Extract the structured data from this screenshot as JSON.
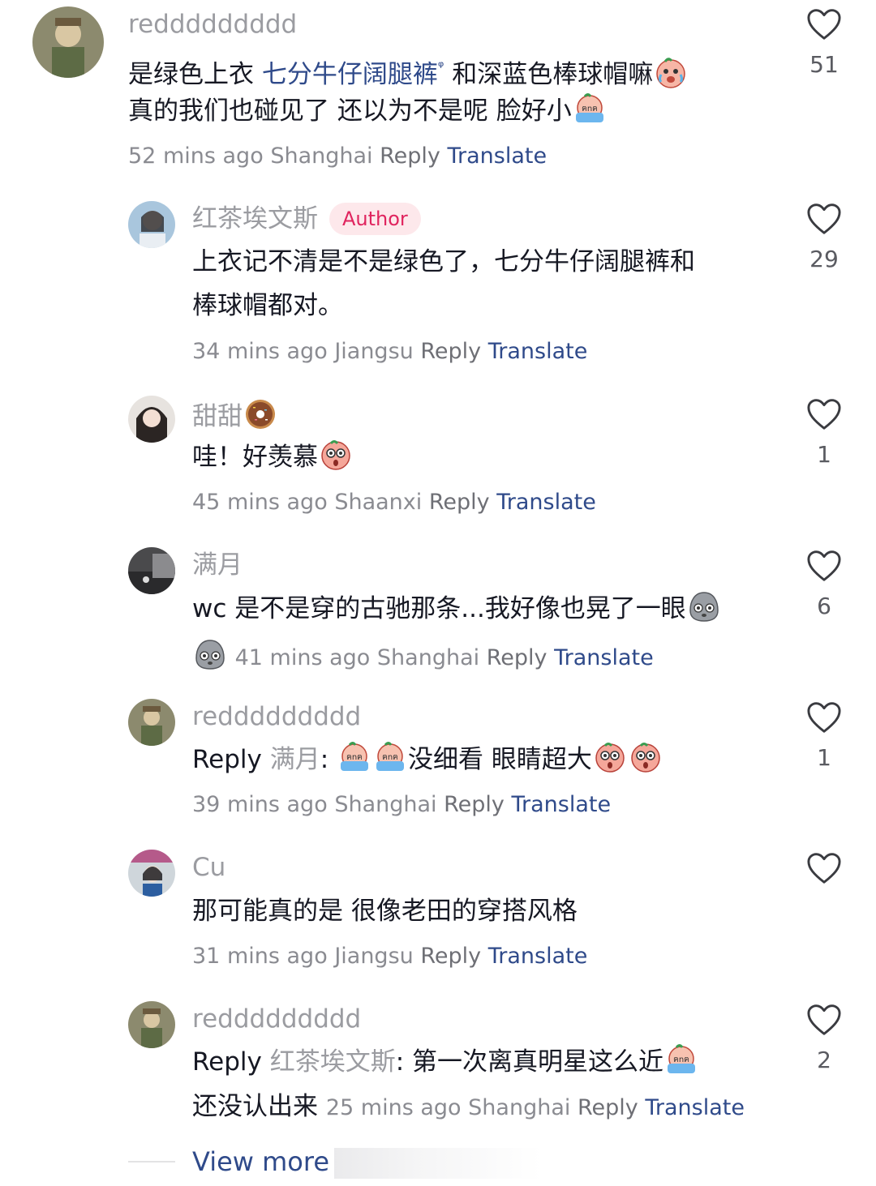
{
  "comments": [
    {
      "username": "reddddddddd",
      "likes": "51",
      "line1_a": "是绿色上衣 ",
      "line1_kw": "七分牛仔阔腿裤",
      "line1_b": " 和深蓝色棒球帽嘛",
      "line2": "真的我们也碰见了 还以为不是呢 脸好小",
      "time": "52 mins ago",
      "location": "Shanghai",
      "reply": "Reply",
      "translate": "Translate"
    },
    {
      "username": "红茶埃文斯",
      "badge": "Author",
      "likes": "29",
      "line1": "上衣记不清是不是绿色了，七分牛仔阔腿裤和",
      "line2": "棒球帽都对。",
      "time": "34 mins ago",
      "location": "Jiangsu",
      "reply": "Reply",
      "translate": "Translate"
    },
    {
      "username": "甜甜",
      "likes": "1",
      "line1": "哇！好羡慕",
      "time": "45 mins ago",
      "location": "Shaanxi",
      "reply": "Reply",
      "translate": "Translate"
    },
    {
      "username": "满月",
      "likes": "6",
      "line1": "wc 是不是穿的古驰那条...我好像也晃了一眼",
      "time": "41 mins ago",
      "location": "Shanghai",
      "reply": "Reply",
      "translate": "Translate"
    },
    {
      "username": "reddddddddd",
      "likes": "1",
      "reply_prefix": "Reply",
      "mention": "满月",
      "colon": ":",
      "line1": "没细看 眼睛超大",
      "time": "39 mins ago",
      "location": "Shanghai",
      "reply": "Reply",
      "translate": "Translate"
    },
    {
      "username": "Cu",
      "likes": "",
      "line1": "那可能真的是 很像老田的穿搭风格",
      "time": "31 mins ago",
      "location": "Jiangsu",
      "reply": "Reply",
      "translate": "Translate"
    },
    {
      "username": "reddddddddd",
      "likes": "2",
      "reply_prefix": "Reply",
      "mention": "红茶埃文斯",
      "colon": ":",
      "line1": "第一次离真明星这么近",
      "line2": "还没认出来",
      "time": "25 mins ago",
      "location": "Shanghai",
      "reply": "Reply",
      "translate": "Translate"
    }
  ],
  "view_more": "View more",
  "colors": {
    "link": "#2f4a8a",
    "badge_bg": "#fde8eb",
    "badge_text": "#e0245e",
    "meta": "#8a8b91"
  },
  "icons": [
    "heart-outline-icon",
    "crying-emoji",
    "sweating-emoji",
    "shocked-emoji",
    "sad-blob-emoji",
    "donut-emoji",
    "search-superscript-icon"
  ]
}
